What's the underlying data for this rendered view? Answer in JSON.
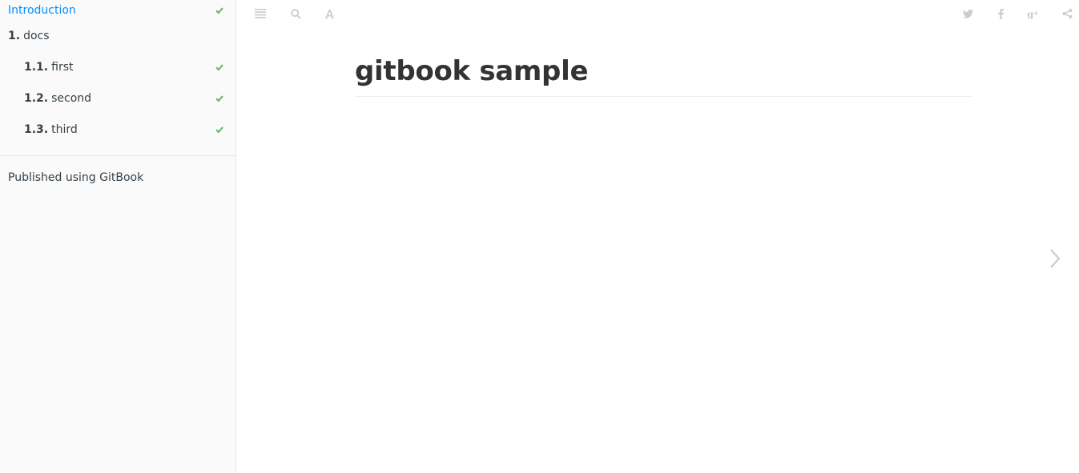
{
  "sidebar": {
    "items": [
      {
        "num": "",
        "label": "Introduction",
        "checked": true,
        "active": true
      },
      {
        "num": "1.",
        "label": "docs",
        "checked": false,
        "active": false
      },
      {
        "num": "1.1.",
        "label": "first",
        "checked": true,
        "active": false
      },
      {
        "num": "1.2.",
        "label": "second",
        "checked": true,
        "active": false
      },
      {
        "num": "1.3.",
        "label": "third",
        "checked": true,
        "active": false
      }
    ],
    "published_label": "Published using GitBook"
  },
  "toolbar": {
    "left_icons": [
      "toc-toggle-icon",
      "search-icon",
      "font-settings-icon"
    ],
    "right_icons": [
      "twitter-icon",
      "facebook-icon",
      "google-plus-icon",
      "share-icon"
    ]
  },
  "main": {
    "title": "gitbook sample"
  },
  "colors": {
    "active_link": "#008cff",
    "check": "#5cb85c",
    "icon_muted": "#cccccc"
  }
}
